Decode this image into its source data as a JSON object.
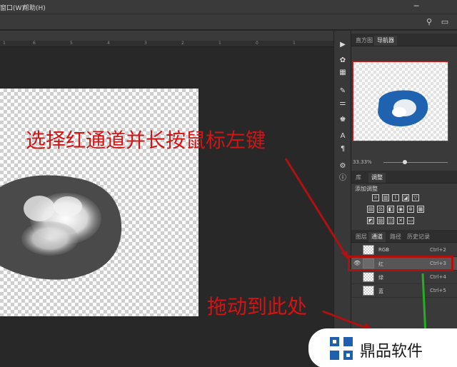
{
  "menubar": {
    "items": [
      "窗口(W)",
      "帮助(H)"
    ]
  },
  "ruler": {
    "ticks": [
      "1",
      "6",
      "5",
      "4",
      "3",
      "2",
      "1",
      "0",
      "1"
    ]
  },
  "annotations": {
    "top": "选择红通道并长按鼠标左键",
    "bottom": "拖动到此处"
  },
  "navigator": {
    "tabs": [
      "直方图",
      "导航器"
    ],
    "active": "导航器",
    "zoom": "33.33%"
  },
  "adjust": {
    "tabs": [
      "库",
      "调整"
    ],
    "active": "调整",
    "heading": "添加调整"
  },
  "channels": {
    "tabs": [
      "图层",
      "通道",
      "路径",
      "历史记录"
    ],
    "active": "通道",
    "rows": [
      {
        "name": "RGB",
        "shortcut": "Ctrl+2",
        "visible": false
      },
      {
        "name": "红",
        "shortcut": "Ctrl+3",
        "visible": true
      },
      {
        "name": "绿",
        "shortcut": "Ctrl+4",
        "visible": false
      },
      {
        "name": "蓝",
        "shortcut": "Ctrl+5",
        "visible": false
      }
    ]
  },
  "watermark": {
    "text": "鼎品软件"
  },
  "colors": {
    "annotation": "#d31414",
    "highlight": "#b01010",
    "drag_line": "#22b022"
  }
}
